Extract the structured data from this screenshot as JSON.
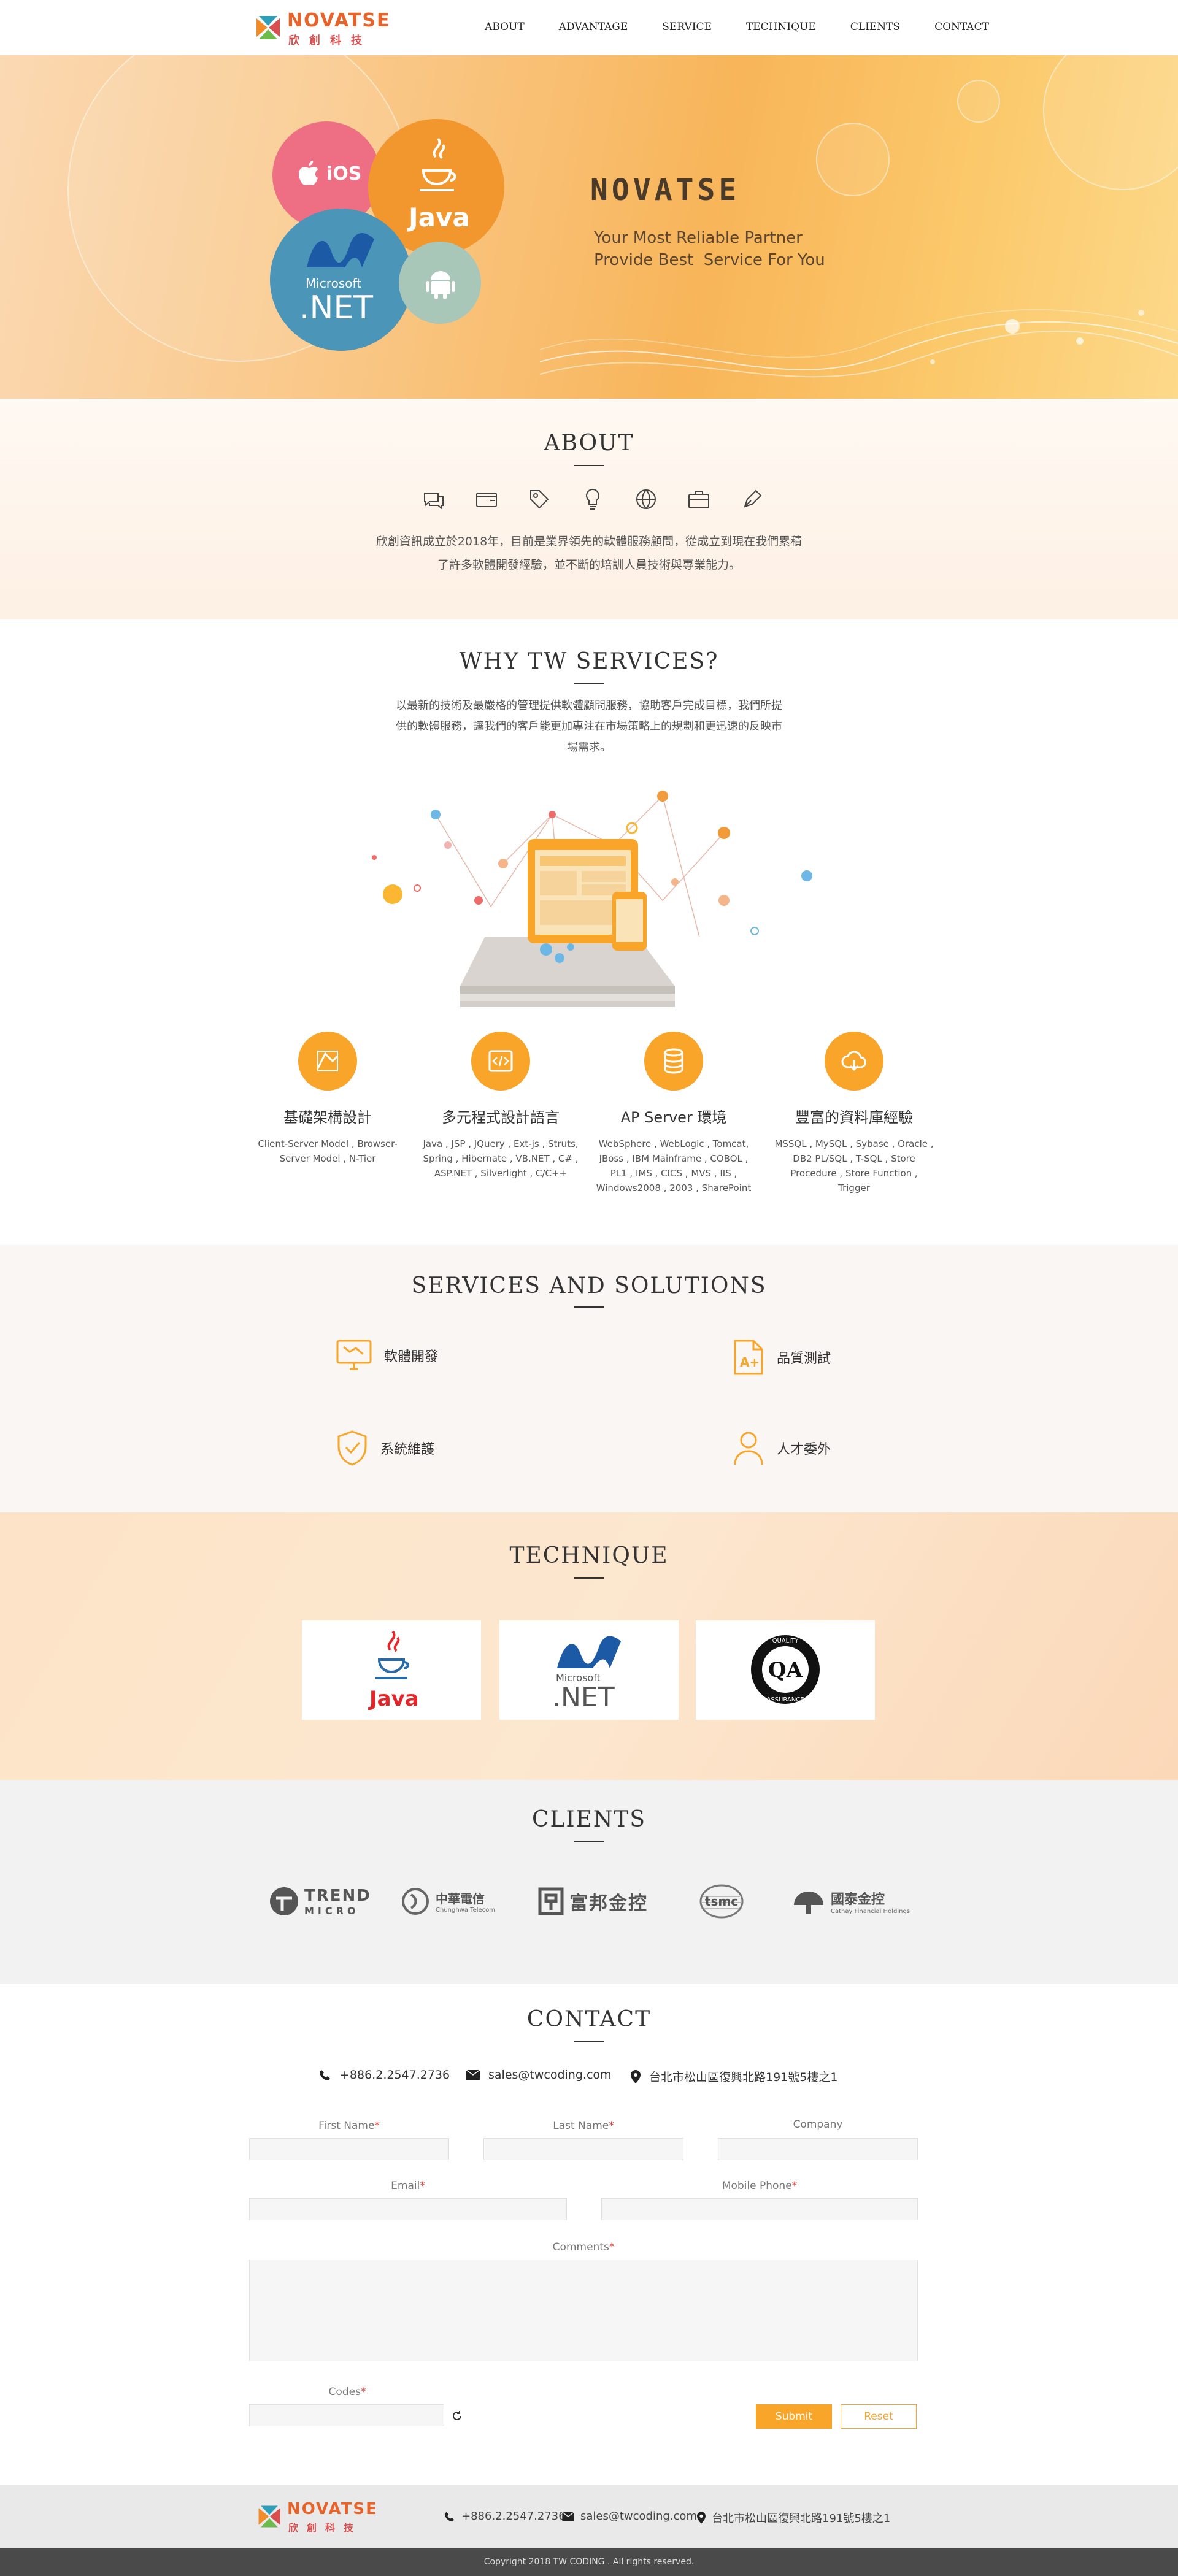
{
  "brand": {
    "name": "NOVATSE",
    "name_cn": "欣創科技"
  },
  "nav": {
    "items": [
      "ABOUT",
      "ADVANTAGE",
      "SERVICE",
      "TECHNIQUE",
      "CLIENTS",
      "CONTACT"
    ]
  },
  "hero": {
    "title": "NOVATSE",
    "line1": "Your Most Reliable Partner",
    "line2": "Provide Best  Service For You",
    "badges": {
      "ios": "iOS",
      "java": "Java",
      "net_small": "Microsoft",
      "net_big": ".NET"
    }
  },
  "about": {
    "title": "ABOUT",
    "icons": [
      "chat-icon",
      "wallet-icon",
      "tag-icon",
      "bulb-icon",
      "globe-icon",
      "briefcase-icon",
      "pen-icon"
    ],
    "text": "欣創資訊成立於2018年，目前是業界領先的軟體服務顧問，從成立到現在我們累積了許多軟體開發經驗，並不斷的培訓人員技術與專業能力。"
  },
  "why": {
    "title": "WHY TW SERVICES?",
    "text": "以最新的技術及最嚴格的管理提供軟體顧問服務，協助客戶完成目標，我們所提供的軟體服務，讓我們的客戶能更加專注在市場策略上的規劃和更迅速的反映市場需求。",
    "features": [
      {
        "title": "基礎架構設計",
        "desc": "Client-Server Model , Browser-Server Model , N-Tier"
      },
      {
        "title": "多元程式設計語言",
        "desc": "Java , JSP , JQuery , Ext-js , Struts, Spring , Hibernate , VB.NET , C# , ASP.NET , Silverlight , C/C++"
      },
      {
        "title": "AP Server 環境",
        "desc": "WebSphere , WebLogic , Tomcat, JBoss , IBM Mainframe , COBOL , PL1 , IMS , CICS , MVS , IIS , Windows2008 , 2003 , SharePoint"
      },
      {
        "title": "豐富的資料庫經驗",
        "desc": "MSSQL , MySQL , Sybase , Oracle , DB2 PL/SQL , T-SQL , Store Procedure , Store Function , Trigger"
      }
    ]
  },
  "services": {
    "title": "SERVICES AND SOLUTIONS",
    "items": [
      "軟體開發",
      "品質測試",
      "系統維護",
      "人才委外"
    ]
  },
  "technique": {
    "title": "TECHNIQUE",
    "cards": [
      {
        "label": "Java"
      },
      {
        "label_small": "Microsoft",
        "label": ".NET"
      },
      {
        "label": "QA",
        "ring_top": "QUALITY",
        "ring_bottom": "ASSURANCE"
      }
    ]
  },
  "clients": {
    "title": "CLIENTS",
    "logos": [
      {
        "name": "TREND",
        "sub": "MICRO"
      },
      {
        "name": "中華電信",
        "sub": "Chunghwa Telecom"
      },
      {
        "name": "富邦金控",
        "sub": ""
      },
      {
        "name": "tsmc",
        "sub": ""
      },
      {
        "name": "國泰金控",
        "sub": "Cathay Financial Holdings"
      }
    ]
  },
  "contact": {
    "title": "CONTACT",
    "phone": "+886.2.2547.2736",
    "email": "sales@twcoding.com",
    "address": "台北市松山區復興北路191號5樓之1",
    "fields": {
      "first_name": "First Name",
      "last_name": "Last Name",
      "company": "Company",
      "email": "Email",
      "mobile": "Mobile Phone",
      "comments": "Comments",
      "codes": "Codes"
    },
    "submit": "Submit",
    "reset": "Reset"
  },
  "footer": {
    "phone": "+886.2.2547.2736",
    "email": "sales@twcoding.com",
    "address": "台北市松山區復興北路191號5樓之1",
    "copyright": "Copyright 2018 TW CODING . All rights reserved."
  },
  "colors": {
    "accent": "#f8a52a",
    "brand_orange": "#e8632a",
    "dark": "#333333"
  }
}
